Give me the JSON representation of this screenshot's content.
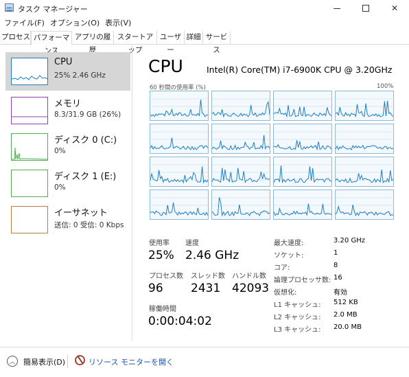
{
  "window": {
    "title": "タスク マネージャー",
    "minimize_label": "",
    "maximize_label": "",
    "close_label": "✕"
  },
  "menu": [
    "ファイル(F)",
    "オプション(O)",
    "表示(V)"
  ],
  "tabs": [
    {
      "label": "プロセス",
      "active": false
    },
    {
      "label": "パフォーマンス",
      "active": true
    },
    {
      "label": "アプリの履歴",
      "active": false
    },
    {
      "label": "スタートアップ",
      "active": false
    },
    {
      "label": "ユーザー",
      "active": false
    },
    {
      "label": "詳細",
      "active": false
    },
    {
      "label": "サービス",
      "active": false
    }
  ],
  "sidebar": [
    {
      "title": "CPU",
      "subtitle": "25%  2.46 GHz",
      "selected": true,
      "color": "#1d7ec4"
    },
    {
      "title": "メモリ",
      "subtitle": "8.3/31.9 GB (26%)",
      "selected": false,
      "color": "#8e44ad"
    },
    {
      "title": "ディスク 0 (C:)",
      "subtitle": "0%",
      "selected": false,
      "color": "#4caf50"
    },
    {
      "title": "ディスク 1 (E:)",
      "subtitle": "0%",
      "selected": false,
      "color": "#4caf50"
    },
    {
      "title": "イーサネット",
      "subtitle": "送信: 0  受信: 0 Kbps",
      "selected": false,
      "color": "#c0793a"
    }
  ],
  "main": {
    "title": "CPU",
    "cpu_name": "Intel(R) Core(TM) i7-6900K CPU @ 3.20GHz",
    "graph_label_left": "60 秒間の使用率 (%)",
    "graph_label_right": "100%",
    "graph_color": "#1d7ec4"
  },
  "stats": {
    "usage_label": "使用率",
    "usage_value": "25%",
    "speed_label": "速度",
    "speed_value": "2.46 GHz",
    "processes_label": "プロセス数",
    "processes_value": "96",
    "threads_label": "スレッド数",
    "threads_value": "2431",
    "handles_label": "ハンドル数",
    "handles_value": "42093",
    "uptime_label": "稼働時間",
    "uptime_value": "0:00:04:02"
  },
  "specs": [
    {
      "label": "最大速度:",
      "value": "3.20 GHz"
    },
    {
      "label": "ソケット:",
      "value": "1"
    },
    {
      "label": "コア:",
      "value": "8"
    },
    {
      "label": "論理プロセッサ数:",
      "value": "16"
    },
    {
      "label": "仮想化:",
      "value": "有効"
    },
    {
      "label": "L1 キャッシュ:",
      "value": "512 KB"
    },
    {
      "label": "L2 キャッシュ:",
      "value": "2.0 MB"
    },
    {
      "label": "L3 キャッシュ:",
      "value": "20.0 MB"
    }
  ],
  "footer": {
    "toggle_label": "簡易表示(D)",
    "toggle_icon": "chevron-up-icon",
    "resource_monitor_label": "リソース モニターを開く",
    "resource_monitor_icon": "resource-monitor-icon"
  }
}
